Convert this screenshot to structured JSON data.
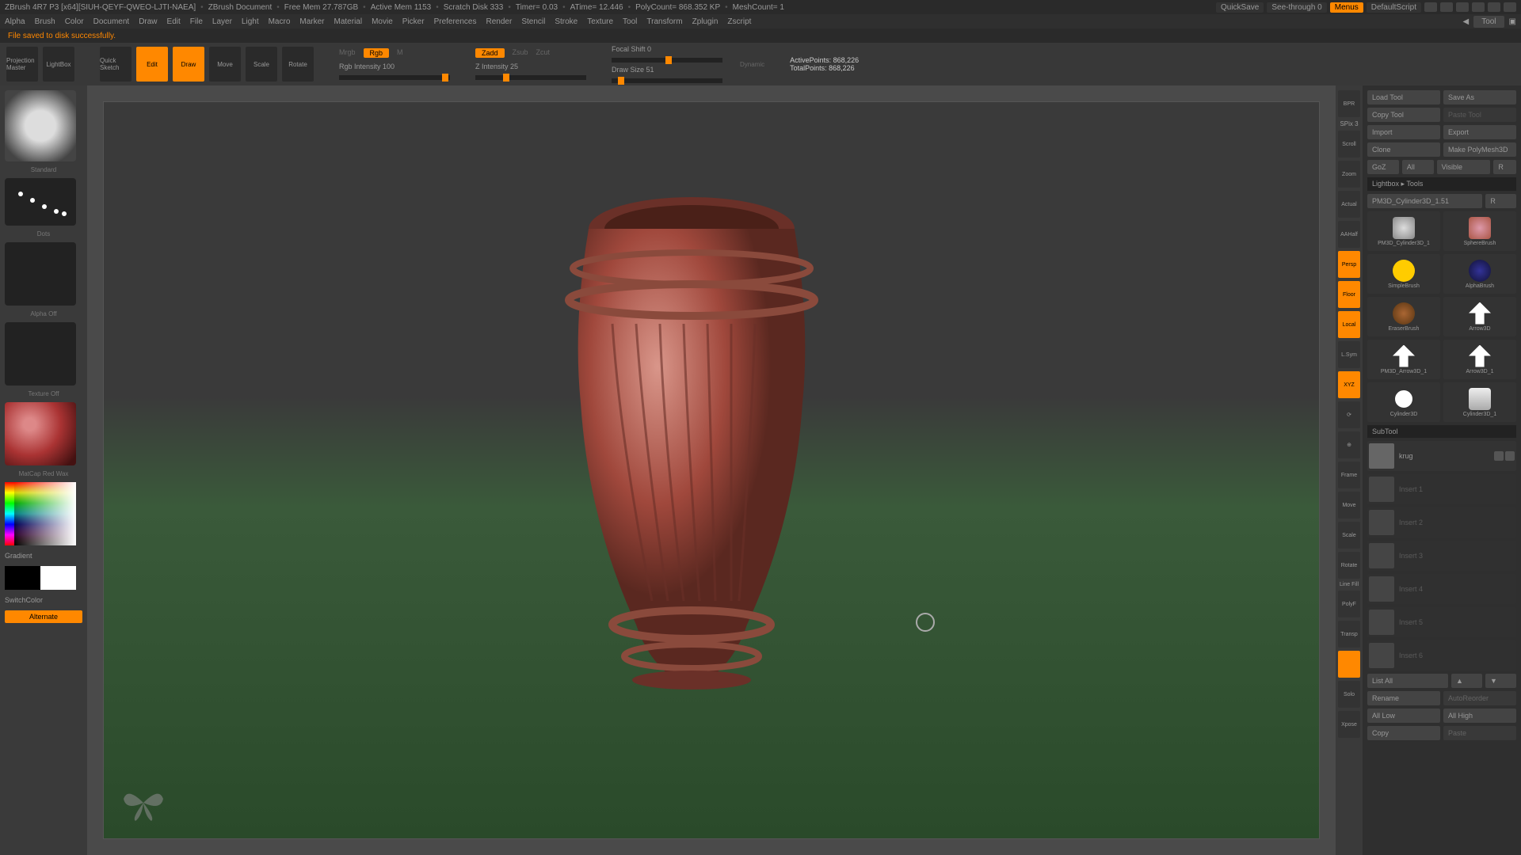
{
  "titlebar": {
    "app": "ZBrush 4R7 P3 [x64][SIUH-QEYF-QWEO-LJTI-NAEA]",
    "doc": "ZBrush Document",
    "freemem": "Free Mem 27.787GB",
    "activemem": "Active Mem 1153",
    "scratch": "Scratch Disk 333",
    "timer": "Timer= 0.03",
    "atime": "ATime= 12.446",
    "polycount": "PolyCount= 868.352 KP",
    "meshcount": "MeshCount= 1",
    "quicksave": "QuickSave",
    "seethrough": "See-through   0",
    "menus": "Menus",
    "defaultscript": "DefaultScript"
  },
  "menubar": {
    "items": [
      "Alpha",
      "Brush",
      "Color",
      "Document",
      "Draw",
      "Edit",
      "File",
      "Layer",
      "Light",
      "Macro",
      "Marker",
      "Material",
      "Movie",
      "Picker",
      "Preferences",
      "Render",
      "Stencil",
      "Stroke",
      "Texture",
      "Tool",
      "Transform",
      "Zplugin",
      "Zscript"
    ],
    "tool": "Tool"
  },
  "status": "File saved to disk successfully.",
  "toolbar": {
    "projection": "Projection Master",
    "lightbox": "LightBox",
    "quicksketch": "Quick Sketch",
    "edit": "Edit",
    "draw": "Draw",
    "move": "Move",
    "scale": "Scale",
    "rotate": "Rotate",
    "mrgb": "Mrgb",
    "rgb": "Rgb",
    "m": "M",
    "rgb_intensity": "Rgb Intensity 100",
    "zadd": "Zadd",
    "zsub": "Zsub",
    "zcut": "Zcut",
    "z_intensity": "Z Intensity 25",
    "focal_shift": "Focal Shift 0",
    "draw_size": "Draw Size 51",
    "dynamic": "Dynamic",
    "active_points": "ActivePoints: 868,226",
    "total_points": "TotalPoints: 868,226"
  },
  "left": {
    "brush_name": "Standard",
    "dots": "Dots",
    "alpha": "Alpha Off",
    "texture": "Texture Off",
    "material": "MatCap Red Wax",
    "gradient": "Gradient",
    "switchcolor": "SwitchColor",
    "alternate": "Alternate"
  },
  "right_tools": {
    "items": [
      "BPR",
      "SPix 3",
      "Scroll",
      "Zoom",
      "Actual",
      "AAHalf",
      "Persp",
      "Floor",
      "Local",
      "L.Sym",
      "XYZ",
      "",
      "",
      "Frame",
      "Move",
      "Scale",
      "Rotate",
      "Line Fill",
      "PolyF",
      "Transp",
      "",
      "Solo",
      "Xpose"
    ],
    "active": [
      6,
      7,
      8,
      10
    ],
    "spix": "SPix 3"
  },
  "right_panel": {
    "load_tool": "Load Tool",
    "save_as": "Save As",
    "copy_tool": "Copy Tool",
    "paste_tool": "Paste Tool",
    "import": "Import",
    "export": "Export",
    "clone": "Clone",
    "make_polymesh": "Make PolyMesh3D",
    "goz": "GoZ",
    "all": "All",
    "visible": "Visible",
    "r": "R",
    "lightbox_tools": "Lightbox ▸ Tools",
    "current_tool": "PM3D_Cylinder3D_1.51",
    "tools": [
      "PM3D_Cylinder3D_1",
      "SphereBrush",
      "SimpleBrush",
      "AlphaBrush",
      "EraserBrush",
      "Arrow3D",
      "PM3D_Arrow3D_1",
      "Arrow3D_1",
      "Cylinder3D",
      "Cylinder3D_1",
      "PM3D_Cylinder3D_1"
    ],
    "subtool": "SubTool",
    "subtools": [
      "krug",
      "Insert 1",
      "Insert 2",
      "Insert 3",
      "Insert 4",
      "Insert 5",
      "Insert 6"
    ],
    "list_all": "List All",
    "rename": "Rename",
    "autoreorder": "AutoReorder",
    "all_low": "All Low",
    "all_high": "All High",
    "copy": "Copy",
    "paste": "Paste"
  }
}
